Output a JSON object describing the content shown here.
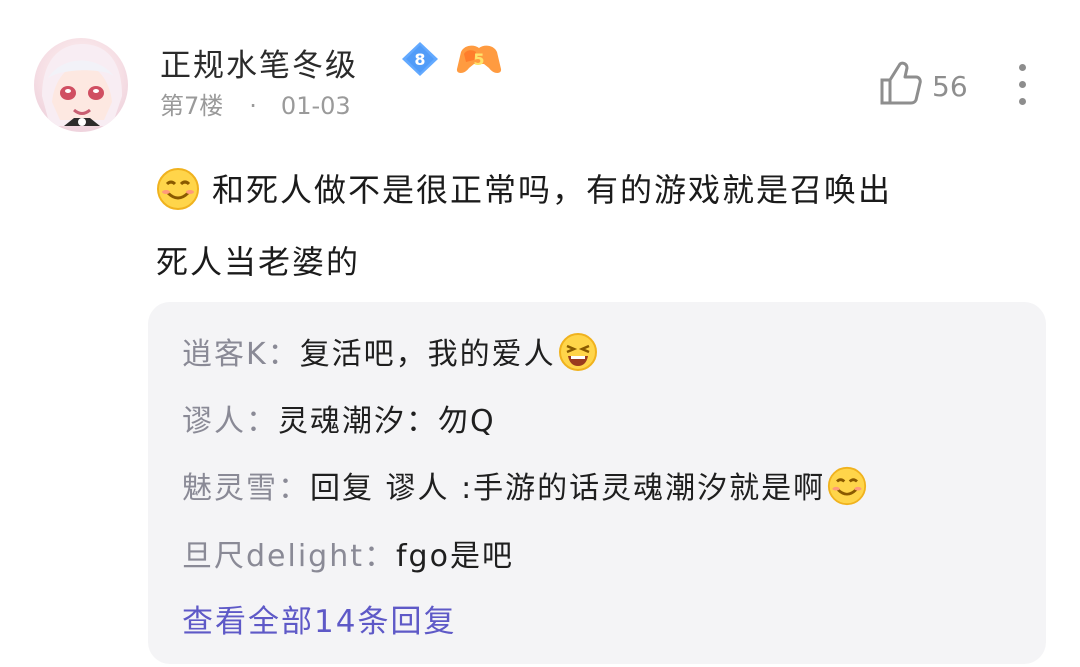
{
  "post": {
    "username": "正规水笔冬级",
    "level": "8",
    "game_badge": "5",
    "floor": "第7楼",
    "separator": "·",
    "date": "01-03",
    "likes": "56",
    "content_line1": "和死人做不是很正常吗，有的游戏就是召唤出",
    "content_line2": "死人当老婆的"
  },
  "replies": [
    {
      "author": "逍客K：",
      "text": "复活吧，我的爱人"
    },
    {
      "author": "谬人：",
      "text": "灵魂潮汐：勿Q"
    },
    {
      "author": "魅灵雪：",
      "text": "回复 谬人 :手游的话灵魂潮汐就是啊"
    },
    {
      "author": "旦尺delight：",
      "text": "fgo是吧"
    }
  ],
  "view_all_label": "查看全部14条回复",
  "colors": {
    "accent": "#5e59c7",
    "level_badge": "#62a9ff",
    "game_badge": "#ff9b40",
    "reply_bg": "#f4f4f6",
    "meta": "#9a9a9a"
  },
  "icons": [
    "avatar",
    "level-badge",
    "game-badge",
    "thumbs-up-icon",
    "more-icon",
    "smile-emoji",
    "laugh-emoji"
  ]
}
